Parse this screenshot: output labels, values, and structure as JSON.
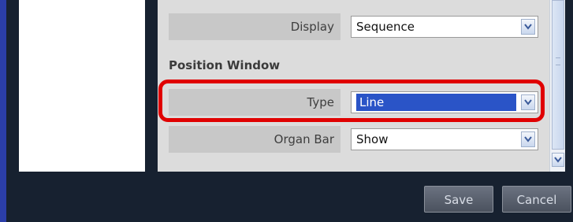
{
  "form": {
    "display": {
      "label": "Display",
      "value": "Sequence"
    },
    "section_title": "Position Window",
    "type": {
      "label": "Type",
      "value": "Line"
    },
    "organ_bar": {
      "label": "Organ Bar",
      "value": "Show"
    }
  },
  "buttons": {
    "save": "Save",
    "cancel": "Cancel"
  },
  "colors": {
    "highlight": "#e00000",
    "selection": "#2a54c7"
  },
  "icons": {
    "dropdown": "chevron-down-icon"
  }
}
